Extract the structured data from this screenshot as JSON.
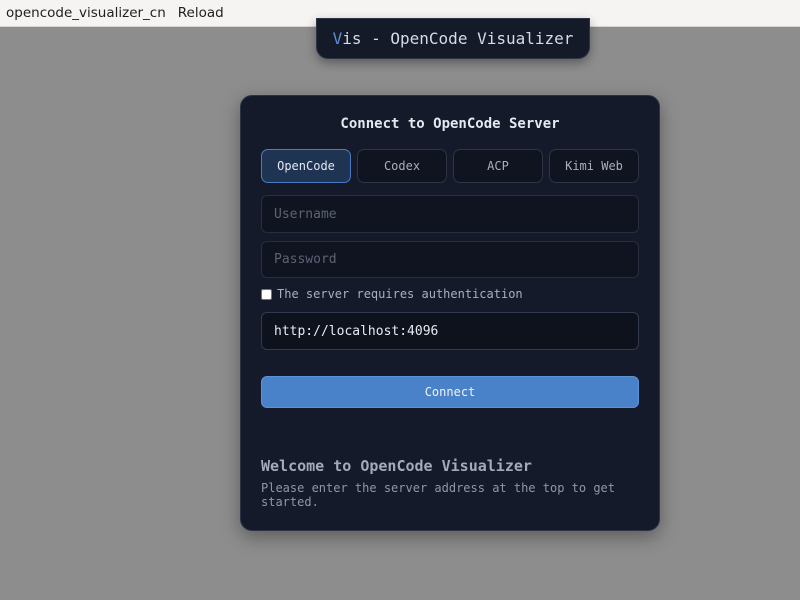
{
  "topbar": {
    "app_name": "opencode_visualizer_cn",
    "reload_label": "Reload"
  },
  "title_pill": {
    "accent_letter": "V",
    "rest": "is - OpenCode Visualizer"
  },
  "login_card": {
    "title": "Connect to OpenCode Server",
    "tabs": [
      {
        "label": "OpenCode",
        "active": true
      },
      {
        "label": "Codex",
        "active": false
      },
      {
        "label": "ACP",
        "active": false
      },
      {
        "label": "Kimi Web",
        "active": false
      }
    ],
    "username": {
      "value": "",
      "placeholder": "Username"
    },
    "password": {
      "value": "",
      "placeholder": "Password"
    },
    "auth_checkbox": {
      "label": "The server requires authentication",
      "checked": false
    },
    "server_url": {
      "value": "http://localhost:4096",
      "placeholder": ""
    },
    "connect_label": "Connect"
  },
  "welcome": {
    "title": "Welcome to OpenCode Visualizer",
    "text": "Please enter the server address at the top to get started."
  },
  "colors": {
    "page_background": "#8d8d8d",
    "card_background": "#141a2a",
    "accent": "#4a82c9",
    "title_accent": "#5d8fd8"
  }
}
